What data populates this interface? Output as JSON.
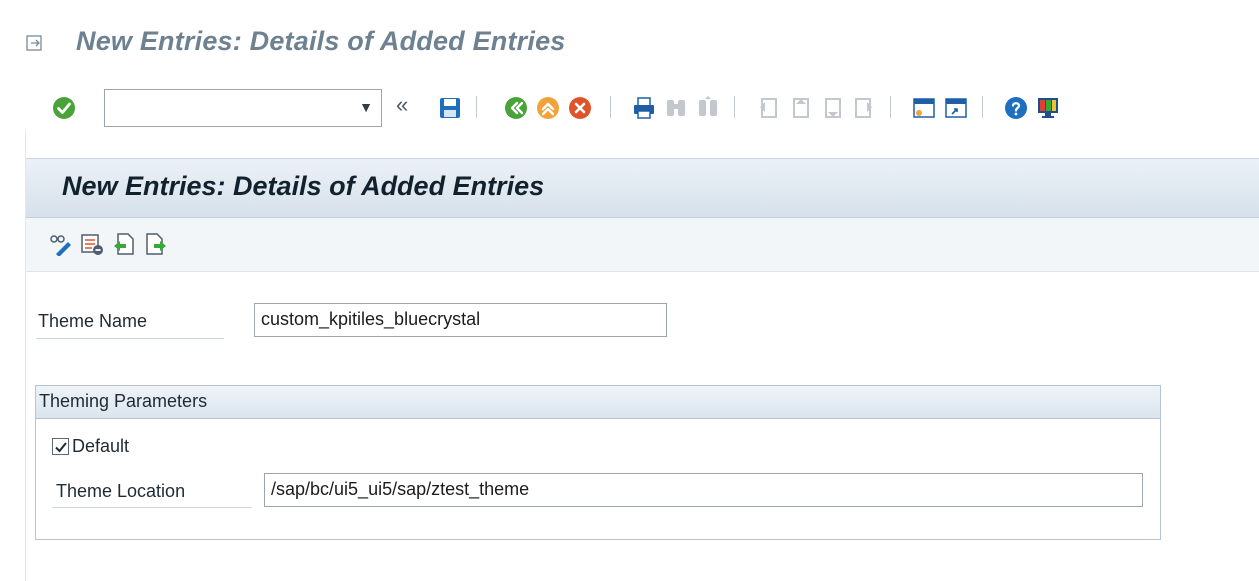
{
  "window": {
    "title": "New Entries: Details of Added Entries",
    "menu_icon": "menu-icon"
  },
  "toolbar": {
    "enter_icon": "enter-checkmark-icon",
    "command_field": {
      "value": "",
      "placeholder": ""
    },
    "icons": [
      "collapse-chevron-icon",
      "save-icon",
      "back-icon",
      "exit-icon",
      "cancel-icon",
      "print-icon",
      "find-icon",
      "find-next-icon",
      "first-page-icon",
      "previous-page-icon",
      "next-page-icon",
      "last-page-icon",
      "create-session-icon",
      "shortcut-icon",
      "help-icon",
      "customize-layout-icon"
    ]
  },
  "panel": {
    "header": "New Entries: Details of Added Entries",
    "app_icons": [
      "change-display-icon",
      "delete-row-icon",
      "previous-entry-icon",
      "next-entry-icon"
    ],
    "theme_name_label": "Theme Name",
    "theme_name_value": "custom_kpitiles_bluecrystal",
    "group": {
      "title": "Theming Parameters",
      "default_label": "Default",
      "default_checked": true,
      "location_label": "Theme Location",
      "location_value": "/sap/bc/ui5_ui5/sap/ztest_theme"
    }
  },
  "colors": {
    "title": "#6e8190",
    "header_bg": "#d6e1eb",
    "enter_green": "#4aa33a",
    "accent_blue": "#1f5fa8"
  }
}
